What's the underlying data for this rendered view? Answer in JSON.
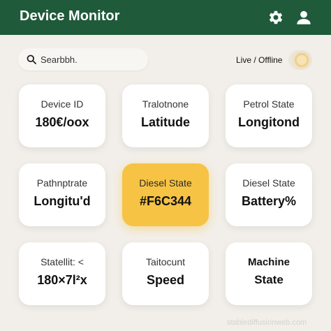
{
  "header": {
    "title": "Device Monitor",
    "settings_icon": "gear-icon",
    "profile_icon": "user-icon",
    "background": "#1f5a3a"
  },
  "toolbar": {
    "search_placeholder": "Searbbh.",
    "search_icon": "search-icon",
    "status_label": "Live / Offline"
  },
  "cards": [
    {
      "label": "Device ID",
      "value": "180€/oox"
    },
    {
      "label": "Tralotnone",
      "value": "Latitude"
    },
    {
      "label": "Petrol State",
      "value": "Longitond"
    },
    {
      "label": "Pathnptrate",
      "value": "Longitu'd"
    },
    {
      "label": "Diesel State",
      "value": "#F6C344",
      "highlight_color": "#F6C344"
    },
    {
      "label": "Diesel State",
      "value": "Battery%"
    },
    {
      "label": "Statellit: <",
      "value": "180×7l²x"
    },
    {
      "label": "Taitocunt",
      "value": "Speed"
    },
    {
      "label": "Machine",
      "value": "State"
    }
  ],
  "watermark": "stablediffusionweb.com"
}
